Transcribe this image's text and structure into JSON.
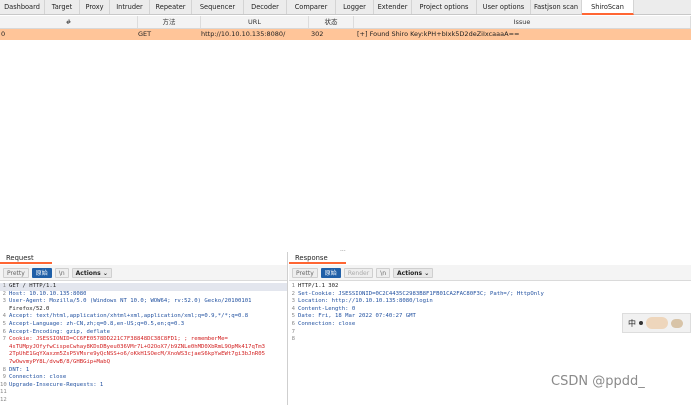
{
  "tabs": [
    "Dashboard",
    "Target",
    "Proxy",
    "Intruder",
    "Repeater",
    "Sequencer",
    "Decoder",
    "Comparer",
    "Logger",
    "Extender",
    "Project options",
    "User options",
    "Fastjson scan",
    "ShiroScan"
  ],
  "active_tab": "ShiroScan",
  "table": {
    "headers": [
      "#",
      "方法",
      "URL",
      "状态",
      "Issue"
    ],
    "rows": [
      {
        "id": "0",
        "method": "GET",
        "url": "http://10.10.10.135:8080/",
        "status": "302",
        "issue": "[+] Found Shiro Key:kPH+bIxk5D2deZiIxcaaaA=="
      }
    ]
  },
  "divider": "...",
  "request": {
    "title": "Request",
    "buttons": {
      "pretty": "Pretty",
      "raw": "原始",
      "newline": "\\n",
      "actions": "Actions"
    },
    "lines": [
      {
        "n": "1",
        "text": "GET / HTTP/1.1"
      },
      {
        "n": "2",
        "text": "Host: 10.10.10.135:8080"
      },
      {
        "n": "3",
        "text": "User-Agent: Mozilla/5.0 (Windows NT 10.0; WOW64; rv:52.0) Gecko/20100101"
      },
      {
        "n": "",
        "text": "Firefox/52.0"
      },
      {
        "n": "4",
        "text": "Accept: text/html,application/xhtml+xml,application/xml;q=0.9,*/*;q=0.8"
      },
      {
        "n": "5",
        "text": "Accept-Language: zh-CN,zh;q=0.8,en-US;q=0.5,en;q=0.3"
      },
      {
        "n": "6",
        "text": "Accept-Encoding: gzip, deflate"
      },
      {
        "n": "7",
        "text": "Cookie: JSESSIONID=CC6FE0578DD221C7F38848DC38C8FD1; ; rememberMe="
      },
      {
        "n": "",
        "text": "4sTUMpyJOfyfwCispeCwhay8KDsDByeu036VMr7L+O2OoX7/b9ZNLe0hMD0XbRmL9OpMk417qTm3"
      },
      {
        "n": "",
        "text": "2TpUhE1GqYXaxzm5ZsP5VMsre9yQcNSS+o6/oKkH1SOecM/XnoWS3cjaeS6kpYwEWt7gi3bJnR05"
      },
      {
        "n": "",
        "text": "7wOwvmyPY8L/dvwB/8/GHBGip+MabQ"
      },
      {
        "n": "8",
        "text": "DNT: 1"
      },
      {
        "n": "9",
        "text": "Connection: close"
      },
      {
        "n": "10",
        "text": "Upgrade-Insecure-Requests: 1"
      },
      {
        "n": "11",
        "text": ""
      },
      {
        "n": "12",
        "text": ""
      }
    ]
  },
  "response": {
    "title": "Response",
    "buttons": {
      "pretty": "Pretty",
      "raw": "原始",
      "render": "Render",
      "newline": "\\n",
      "actions": "Actions"
    },
    "lines": [
      {
        "n": "1",
        "text": "HTTP/1.1 302"
      },
      {
        "n": "2",
        "text": "Set-Cookie: JSESSIONID=0C2C4435C2983B8F1FB01CA2FAC80F3C; Path=/; HttpOnly"
      },
      {
        "n": "3",
        "text": "Location: http://10.10.10.135:8080/login"
      },
      {
        "n": "4",
        "text": "Content-Length: 0"
      },
      {
        "n": "5",
        "text": "Date: Fri, 18 Mar 2022 07:40:27 GMT"
      },
      {
        "n": "6",
        "text": "Connection: close"
      },
      {
        "n": "7",
        "text": ""
      },
      {
        "n": "8",
        "text": ""
      }
    ]
  },
  "ime": {
    "label": "中"
  },
  "watermark": "CSDN @ppdd_"
}
